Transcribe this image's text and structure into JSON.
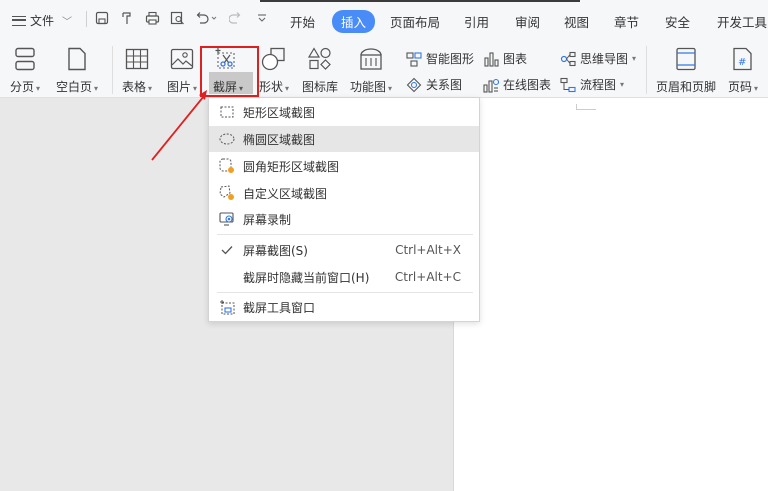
{
  "menubar": {
    "file_label": "文件",
    "tabs": [
      "开始",
      "插入",
      "页面布局",
      "引用",
      "审阅",
      "视图",
      "章节",
      "安全",
      "开发工具"
    ],
    "active_tab": "插入"
  },
  "ribbon": {
    "page_break": "分页",
    "blank_page": "空白页",
    "table": "表格",
    "picture": "图片",
    "screenshot": "截屏",
    "shape": "形状",
    "icon_library": "图标库",
    "function_chart": "功能图",
    "smart_graphic": "智能图形",
    "chart": "图表",
    "mind_map": "思维导图",
    "relation_chart": "关系图",
    "online_chart": "在线图表",
    "flowchart": "流程图",
    "header_footer": "页眉和页脚",
    "page_number": "页码"
  },
  "dropdown": {
    "items": [
      {
        "label": "矩形区域截图",
        "icon": "rect-select-icon"
      },
      {
        "label": "椭圆区域截图",
        "icon": "ellipse-select-icon"
      },
      {
        "label": "圆角矩形区域截图",
        "icon": "rounded-rect-select-icon"
      },
      {
        "label": "自定义区域截图",
        "icon": "custom-select-icon"
      },
      {
        "label": "屏幕录制",
        "icon": "screen-record-icon"
      },
      {
        "label": "屏幕截图(S)",
        "shortcut": "Ctrl+Alt+X",
        "icon": "check-icon"
      },
      {
        "label": "截屏时隐藏当前窗口(H)",
        "shortcut": "Ctrl+Alt+C"
      },
      {
        "label": "截屏工具窗口",
        "icon": "tool-window-icon"
      }
    ]
  },
  "colors": {
    "accent": "#4a8cf7",
    "highlight_red": "#e02020",
    "menu_hover": "#e6e6e6"
  }
}
